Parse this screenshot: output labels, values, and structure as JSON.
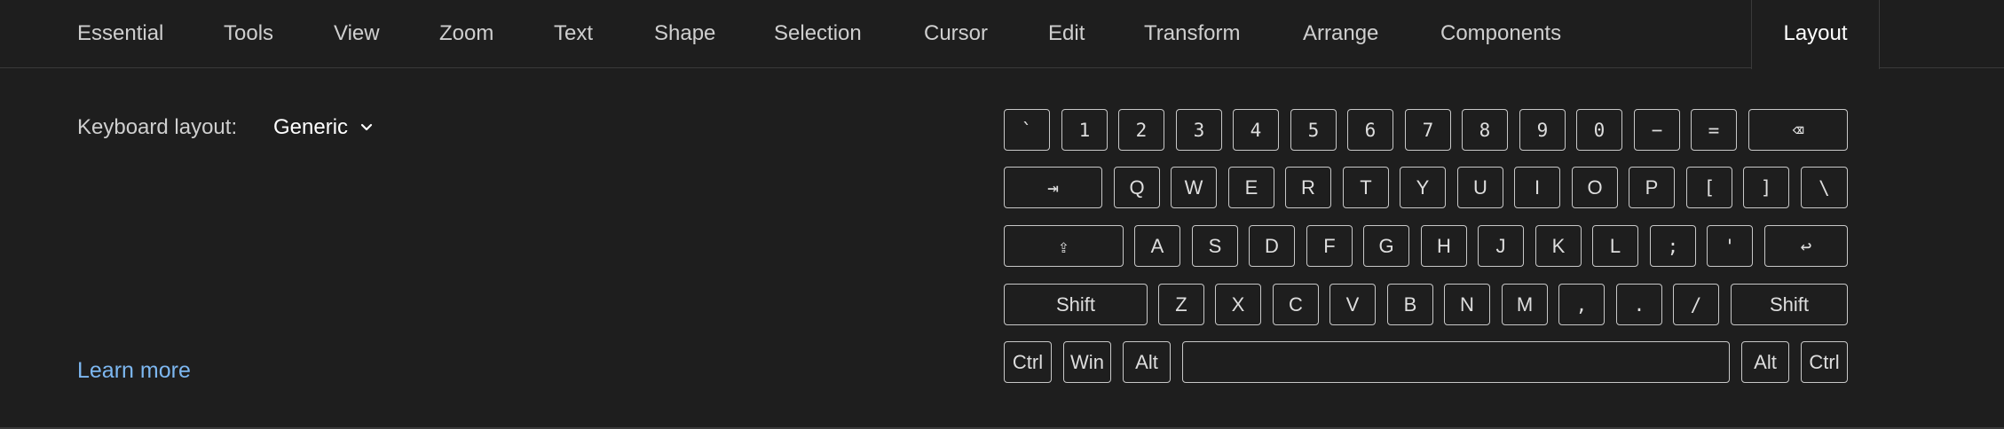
{
  "tabs": [
    {
      "label": "Essential",
      "active": false
    },
    {
      "label": "Tools",
      "active": false
    },
    {
      "label": "View",
      "active": false
    },
    {
      "label": "Zoom",
      "active": false
    },
    {
      "label": "Text",
      "active": false
    },
    {
      "label": "Shape",
      "active": false
    },
    {
      "label": "Selection",
      "active": false
    },
    {
      "label": "Cursor",
      "active": false
    },
    {
      "label": "Edit",
      "active": false
    },
    {
      "label": "Transform",
      "active": false
    },
    {
      "label": "Arrange",
      "active": false
    },
    {
      "label": "Components",
      "active": false
    },
    {
      "label": "Layout",
      "active": true
    }
  ],
  "settings": {
    "keyboard_layout_label": "Keyboard layout:",
    "keyboard_layout_value": "Generic",
    "learn_more": "Learn more"
  },
  "keyboard": {
    "rows": [
      [
        "`",
        "1",
        "2",
        "3",
        "4",
        "5",
        "6",
        "7",
        "8",
        "9",
        "0",
        "−",
        "=",
        "⌫"
      ],
      [
        "⇥",
        "Q",
        "W",
        "E",
        "R",
        "T",
        "Y",
        "U",
        "I",
        "O",
        "P",
        "[",
        "]",
        "\\"
      ],
      [
        "⇪",
        "A",
        "S",
        "D",
        "F",
        "G",
        "H",
        "J",
        "K",
        "L",
        ";",
        "'",
        "↩"
      ],
      [
        "Shift",
        "Z",
        "X",
        "C",
        "V",
        "B",
        "N",
        "M",
        ",",
        ".",
        "/",
        "Shift"
      ],
      [
        "Ctrl",
        "Win",
        "Alt",
        "",
        "Alt",
        "Ctrl"
      ]
    ]
  }
}
